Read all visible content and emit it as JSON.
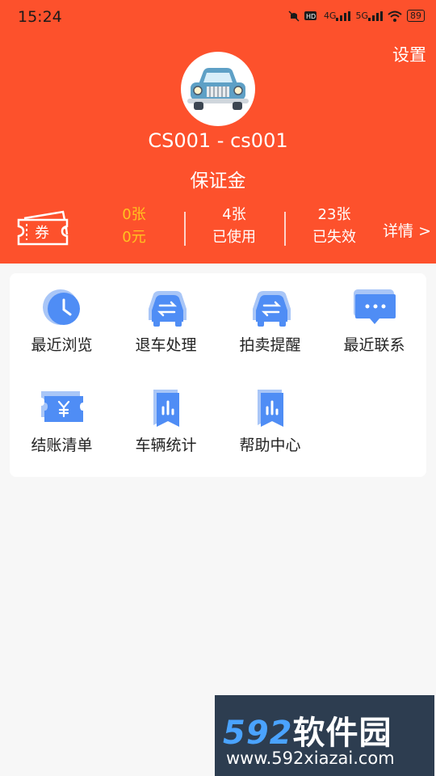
{
  "status_bar": {
    "time": "15:24",
    "network_1": "4G",
    "network_2": "5G",
    "battery": "89"
  },
  "header": {
    "settings_label": "设置",
    "account_name": "CS001 - cs001",
    "deposit_label": "保证金",
    "coupon_icon_text": "券",
    "stats": [
      {
        "line1": "0张",
        "line2": "0元"
      },
      {
        "line1": "4张",
        "line2": "已使用"
      },
      {
        "line1": "23张",
        "line2": "已失效"
      }
    ],
    "details_label": "详情 >"
  },
  "menu": {
    "items": [
      {
        "label": "最近浏览",
        "icon": "clock-icon"
      },
      {
        "label": "退车处理",
        "icon": "car-exchange-icon"
      },
      {
        "label": "拍卖提醒",
        "icon": "car-exchange-icon"
      },
      {
        "label": "最近联系",
        "icon": "message-icon"
      },
      {
        "label": "结账清单",
        "icon": "yen-ticket-icon"
      },
      {
        "label": "车辆统计",
        "icon": "chart-bookmark-icon"
      },
      {
        "label": "帮助中心",
        "icon": "chart-bookmark-icon"
      }
    ]
  },
  "watermark": {
    "logo_num": "592",
    "logo_text": "软件园",
    "url": "www.592xiazai.com"
  },
  "colors": {
    "header_bg": "#fd512c",
    "highlight": "#ffc320",
    "icon_blue": "#4f8df5"
  }
}
